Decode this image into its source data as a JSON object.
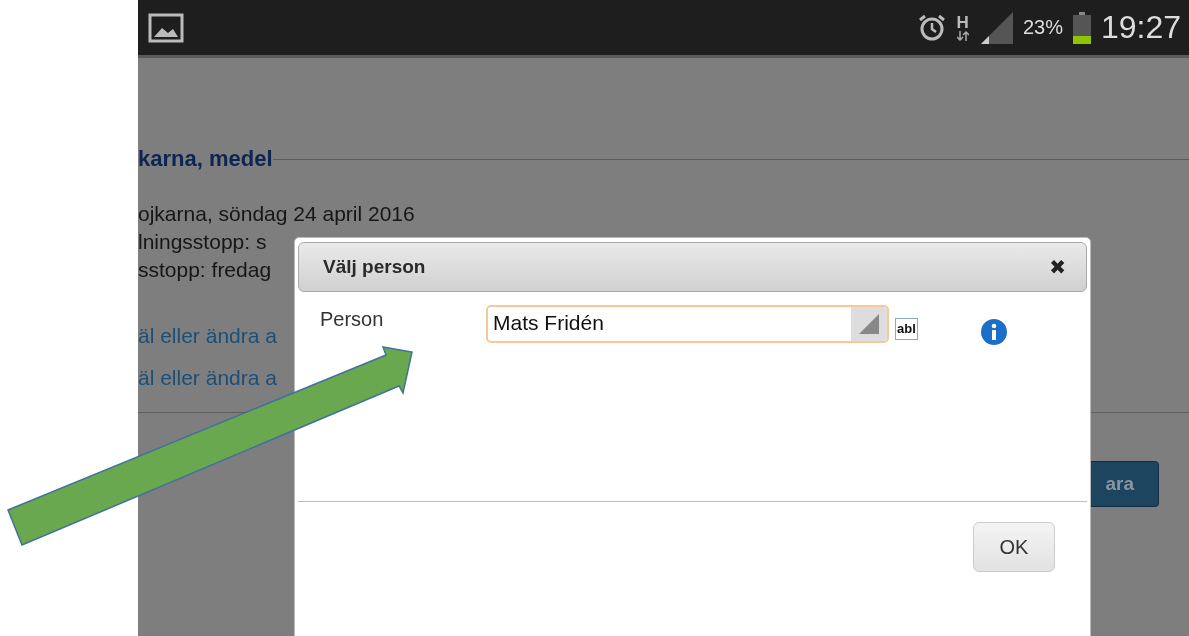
{
  "status_bar": {
    "network": "H",
    "battery_text": "23%",
    "time": "19:27"
  },
  "page": {
    "heading": "karna, medel",
    "lines": [
      "ojkarna, söndag 24 april 2016",
      "lningsstopp: s",
      "sstopp: fredag"
    ],
    "links": [
      "äl eller ändra a",
      "äl eller ändra a"
    ],
    "button": "ara"
  },
  "dialog": {
    "title": "Välj person",
    "close": "✖",
    "fields": [
      {
        "label": "Person",
        "value": "Mats Fridén",
        "badge": "abl"
      }
    ],
    "buttons": [
      "OK"
    ]
  }
}
